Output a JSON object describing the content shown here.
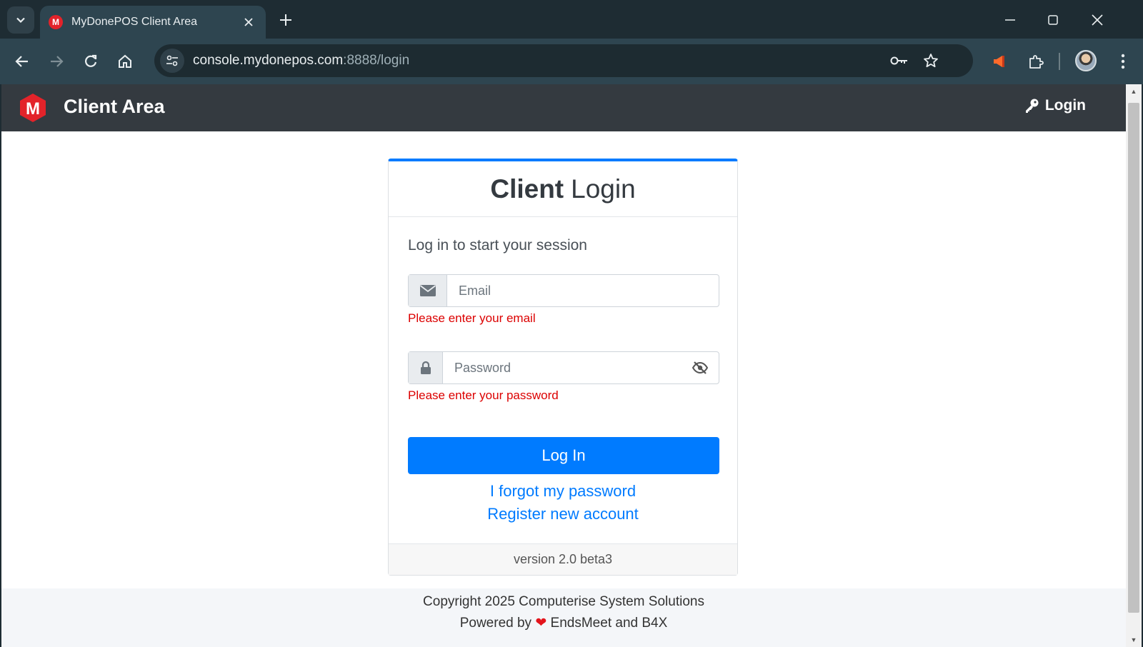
{
  "browser": {
    "tab_title": "MyDonePOS Client Area",
    "favicon_letter": "M",
    "url_host": "console.mydonepos.com",
    "url_rest": ":8888/login"
  },
  "navbar": {
    "brand_letter": "M",
    "brand_text": "Client Area",
    "login_label": "Login"
  },
  "card": {
    "title_bold": "Client",
    "title_rest": "Login",
    "message": "Log in to start your session",
    "email_placeholder": "Email",
    "email_error": "Please enter your email",
    "password_placeholder": "Password",
    "password_error": "Please enter your password",
    "login_button": "Log In",
    "forgot_link": "I forgot my password",
    "register_link": "Register new account",
    "version": "version 2.0 beta3"
  },
  "footer": {
    "copyright": "Copyright 2025 Computerise System Solutions",
    "powered_prefix": "Powered by",
    "heart": "❤",
    "powered_suffix": "EndsMeet and B4X"
  },
  "colors": {
    "accent": "#007bff",
    "navbar_bg": "#343a40",
    "error": "#dc0000",
    "brand_red": "#e3232a"
  }
}
